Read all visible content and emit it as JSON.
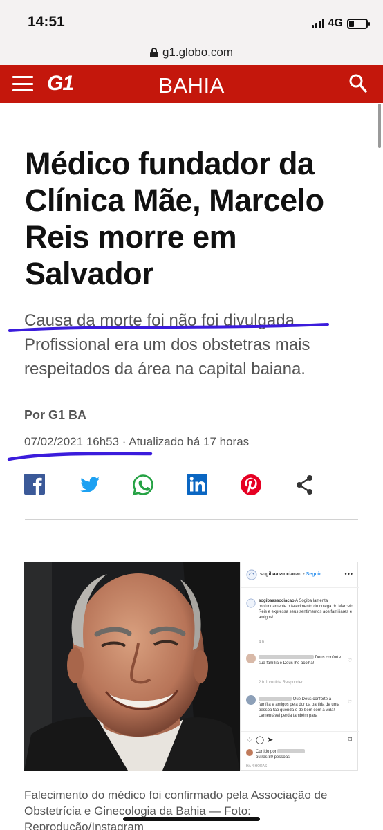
{
  "status_bar": {
    "time": "14:51",
    "network": "4G"
  },
  "browser": {
    "url": "g1.globo.com"
  },
  "header": {
    "logo": "G1",
    "section": "BAHIA",
    "brand_color": "#c4170c"
  },
  "article": {
    "headline": "Médico fundador da Clínica Mãe, Marcelo Reis morre em Salvador",
    "subtitle": "Causa da morte foi não foi divulgada. Profissional era um dos obstetras mais respeitados da área na capital baiana.",
    "byline": "Por G1 BA",
    "dateline": "07/02/2021 16h53 · Atualizado há 17 horas",
    "share": [
      "facebook-icon",
      "twitter-icon",
      "whatsapp-icon",
      "linkedin-icon",
      "pinterest-icon",
      "share-icon"
    ],
    "caption": "Falecimento do médico foi confirmado pela Associação de Obstetrícia e Ginecologia da Bahia — Foto: Reprodução/Instagram"
  },
  "instagram": {
    "account": "sogibaassociacao",
    "follow": "Seguir",
    "post_text": "A Sogiba lamenta profundamente o falecimento do colega dr. Marcelo Reis e expressa seus sentimentos aos familiares e amigos!",
    "post_age": "4 h",
    "comments": [
      {
        "text": "Deus conforte sua família e Deus lhe acolha!",
        "meta": "2 h   1 curtida   Responder"
      },
      {
        "text": "Que Deus conforte a família e amigos pela dor da partida de uma pessoa tão querida e de bem com a vida! Lamentável perda também para"
      }
    ],
    "likes_line1": "Curtido por",
    "likes_line2": "outras 80 pessoas",
    "post_time": "HÁ 4 HORAS"
  },
  "annotation_color": "#3b1cdc"
}
